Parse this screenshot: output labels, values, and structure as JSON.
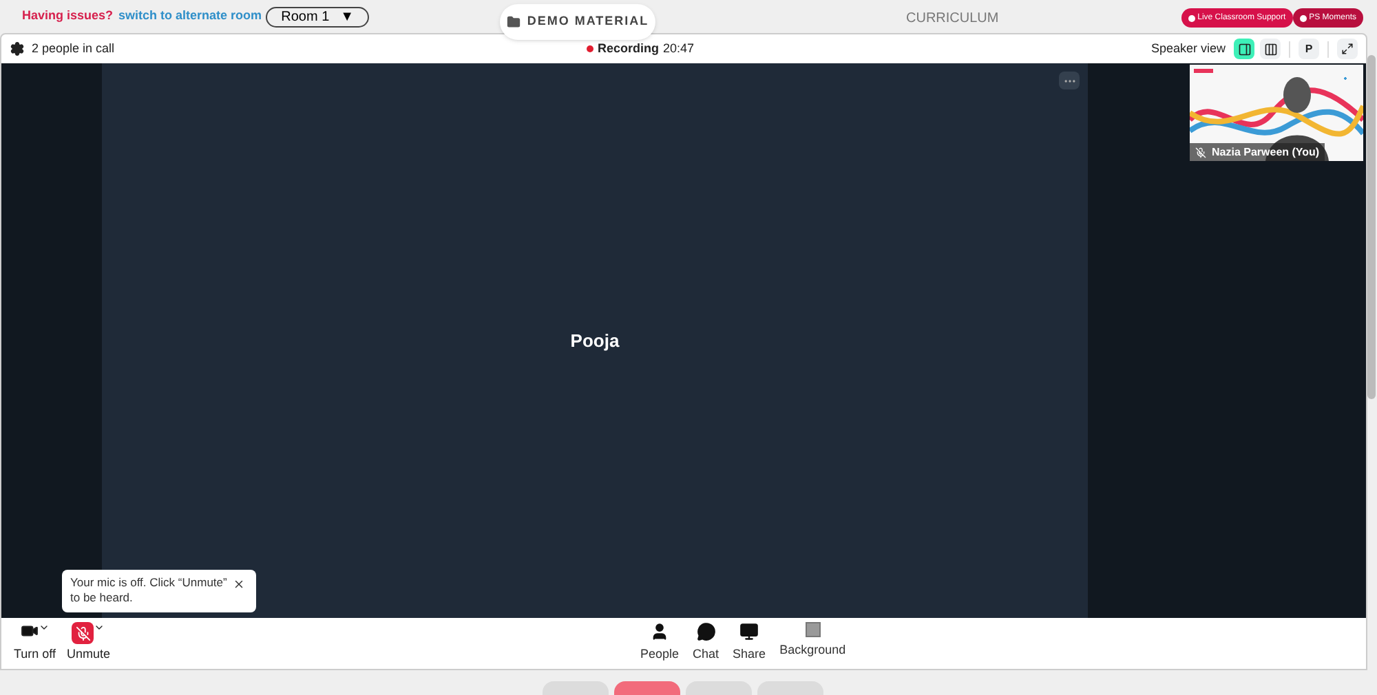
{
  "top_bar": {
    "issue_text": "Having issues?",
    "alternate_link": "switch to alternate room",
    "room_select": "Room 1",
    "room_caret": "▼",
    "demo_button": "DEMO MATERIAL",
    "curriculum": "CURRICULUM",
    "support_buttons": [
      "Live Classroom Support",
      "PS Moments"
    ]
  },
  "call_header": {
    "people_count": "2 people in call",
    "recording": true,
    "recording_label": "Recording",
    "recording_time": "20:47",
    "view_label": "Speaker view",
    "view_buttons": [
      {
        "kind": "speaker",
        "selected": true
      },
      {
        "kind": "grid",
        "selected": false
      }
    ],
    "participant_initial": "P"
  },
  "stage": {
    "speaker_name": "Pooja",
    "self_tile": {
      "name": "Nazia Parween (You)",
      "muted": true
    }
  },
  "toast": {
    "message": "Your mic is off. Click “Unmute” to be heard."
  },
  "controls": {
    "left": [
      {
        "kind": "camera",
        "label": "Turn off",
        "off": false
      },
      {
        "kind": "mic",
        "label": "Unmute",
        "off": true
      }
    ],
    "center": [
      {
        "kind": "people",
        "label": "People"
      },
      {
        "kind": "chat",
        "label": "Chat"
      },
      {
        "kind": "share",
        "label": "Share"
      },
      {
        "kind": "background",
        "label": "Background"
      }
    ]
  },
  "bottom_tabs": [
    {
      "selected": false
    },
    {
      "selected": true
    },
    {
      "selected": false
    },
    {
      "selected": false
    }
  ]
}
